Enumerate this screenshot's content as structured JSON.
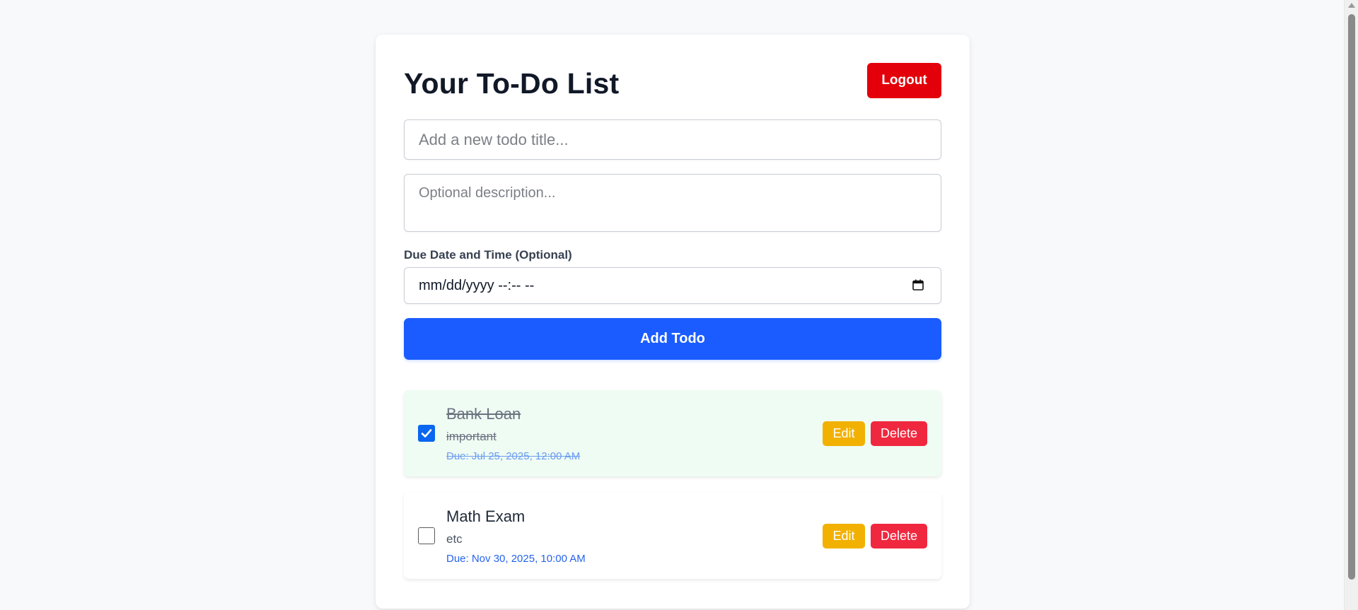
{
  "header": {
    "title": "Your To-Do List",
    "logout_label": "Logout"
  },
  "form": {
    "title_placeholder": "Add a new todo title...",
    "title_value": "",
    "description_placeholder": "Optional description...",
    "description_value": "",
    "due_label": "Due Date and Time (Optional)",
    "due_value": "mm/dd/yyyy --:-- --",
    "add_label": "Add Todo"
  },
  "todos": [
    {
      "title": "Bank Loan",
      "description": "important",
      "due": "Due: Jul 25, 2025, 12:00 AM",
      "completed": true,
      "edit_label": "Edit",
      "delete_label": "Delete"
    },
    {
      "title": "Math Exam",
      "description": "etc",
      "due": "Due: Nov 30, 2025, 10:00 AM",
      "completed": false,
      "edit_label": "Edit",
      "delete_label": "Delete"
    }
  ],
  "colors": {
    "logout": "#e3000b",
    "primary": "#1a5cff",
    "edit": "#f2b100",
    "delete": "#f0283f",
    "completed_bg": "#effcf3"
  },
  "icons": {
    "due_picker": "calendar-icon",
    "completed_check": "checkmark-icon"
  }
}
